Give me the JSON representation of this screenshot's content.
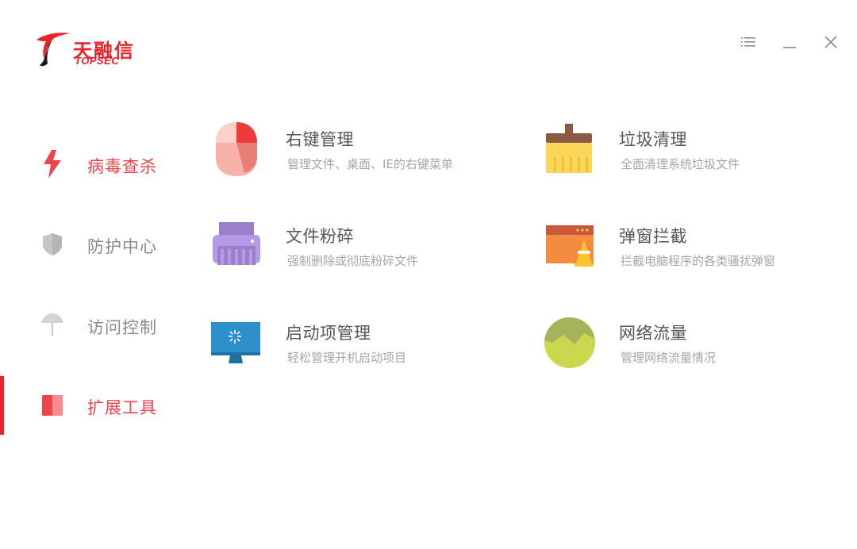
{
  "brand": {
    "name_cn": "天融信",
    "name_en": "TOPSEC",
    "color": "#e8232b"
  },
  "window_controls": {
    "menu_icon": "list-menu-icon",
    "minimize_icon": "minimize-icon",
    "close_icon": "close-icon"
  },
  "sidebar": {
    "items": [
      {
        "label": "病毒查杀",
        "icon": "lightning-icon",
        "active": false,
        "color": "#f0444c"
      },
      {
        "label": "防护中心",
        "icon": "shield-icon",
        "active": false,
        "color": "#8a8a8a"
      },
      {
        "label": "访问控制",
        "icon": "umbrella-icon",
        "active": false,
        "color": "#8a8a8a"
      },
      {
        "label": "扩展工具",
        "icon": "toolbox-icon",
        "active": true,
        "color": "#f0444c"
      }
    ]
  },
  "tools": [
    {
      "title": "右键管理",
      "desc": "管理文件、桌面、IE的右键菜单",
      "icon": "mouse-icon"
    },
    {
      "title": "垃圾清理",
      "desc": "全面清理系统垃圾文件",
      "icon": "broom-icon"
    },
    {
      "title": "文件粉碎",
      "desc": "强制删除或彻底粉碎文件",
      "icon": "shredder-icon"
    },
    {
      "title": "弹窗拦截",
      "desc": "拦截电脑程序的各类骚扰弹窗",
      "icon": "popup-block-icon"
    },
    {
      "title": "启动项管理",
      "desc": "轻松管理开机启动项目",
      "icon": "monitor-icon"
    },
    {
      "title": "网络流量",
      "desc": "管理网络流量情况",
      "icon": "network-traffic-icon"
    }
  ]
}
